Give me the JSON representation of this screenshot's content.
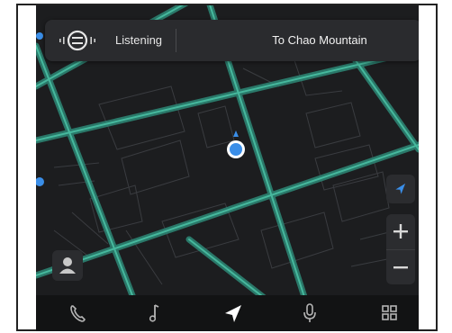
{
  "voice": {
    "status": "Listening",
    "icon": "voice-assistant-icon"
  },
  "navigation": {
    "destination": "To Chao Mountain"
  },
  "map_controls": {
    "locate_icon": "compass-icon",
    "zoom_in_icon": "plus-icon",
    "zoom_out_icon": "minus-icon",
    "profile_icon": "person-icon"
  },
  "bottom_nav": {
    "items": [
      {
        "name": "phone",
        "icon": "phone-icon"
      },
      {
        "name": "music",
        "icon": "music-note-icon"
      },
      {
        "name": "navigation",
        "icon": "navigation-arrow-icon",
        "active": true
      },
      {
        "name": "voice",
        "icon": "microphone-icon"
      },
      {
        "name": "apps",
        "icon": "grid-icon"
      }
    ]
  },
  "colors": {
    "road": "#2f8a78",
    "road_glow": "#3fb598",
    "background": "#1b1c1e",
    "location": "#3a8ee8"
  }
}
